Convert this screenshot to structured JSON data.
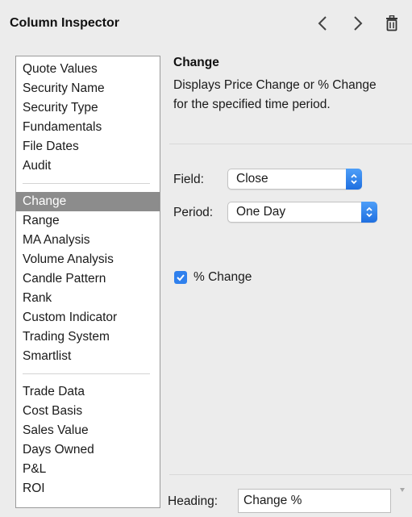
{
  "window": {
    "title": "Column Inspector"
  },
  "icons": {
    "prev": "chevron-left-icon",
    "next": "chevron-right-icon",
    "trash": "trash-icon",
    "checkmark": "checkmark-icon",
    "select_arrows": "updown-arrows-icon",
    "scroll_down": "triangle-down-icon"
  },
  "colors": {
    "accent": "#2f80ed",
    "selection": "#8c8c8c"
  },
  "sidebar": {
    "groups": [
      [
        "Quote Values",
        "Security Name",
        "Security Type",
        "Fundamentals",
        "File Dates",
        "Audit"
      ],
      [
        "Change",
        "Range",
        "MA Analysis",
        "Volume Analysis",
        "Candle Pattern",
        "Rank",
        "Custom Indicator",
        "Trading System",
        "Smartlist"
      ],
      [
        "Trade Data",
        "Cost Basis",
        "Sales Value",
        "Days Owned",
        "P&L",
        "ROI"
      ]
    ],
    "selected": "Change"
  },
  "detail": {
    "title": "Change",
    "description": "Displays Price Change or % Change for the specified time period.",
    "field_label": "Field:",
    "field_value": "Close",
    "period_label": "Period:",
    "period_value": "One Day",
    "percent_change_label": "% Change",
    "percent_change_checked": true,
    "heading_label": "Heading:",
    "heading_value": "Change %"
  }
}
